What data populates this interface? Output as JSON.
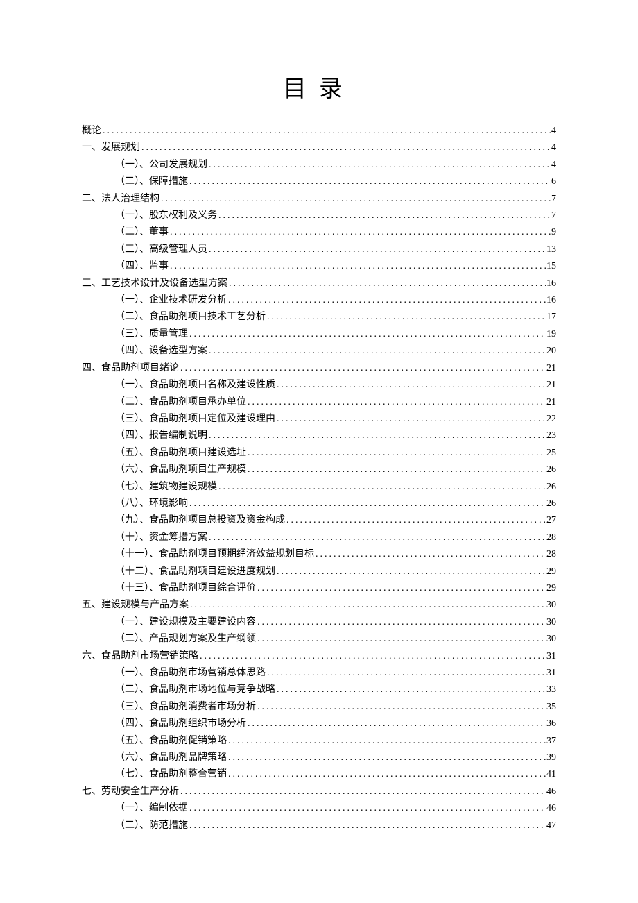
{
  "title": "目录",
  "toc": [
    {
      "level": 1,
      "label": "概论",
      "page": "4"
    },
    {
      "level": 1,
      "label": "一、发展规划",
      "page": "4"
    },
    {
      "level": 2,
      "label": "（一）、公司发展规划",
      "page": "4"
    },
    {
      "level": 2,
      "label": "（二）、保障措施",
      "page": "6"
    },
    {
      "level": 1,
      "label": "二、法人治理结构",
      "page": "7"
    },
    {
      "level": 2,
      "label": "（一）、股东权利及义务",
      "page": "7"
    },
    {
      "level": 2,
      "label": "（二）、董事",
      "page": "9"
    },
    {
      "level": 2,
      "label": "（三）、高级管理人员",
      "page": "13"
    },
    {
      "level": 2,
      "label": "（四）、监事",
      "page": "15"
    },
    {
      "level": 1,
      "label": "三、工艺技术设计及设备选型方案",
      "page": "16"
    },
    {
      "level": 2,
      "label": "（一）、企业技术研发分析",
      "page": "16"
    },
    {
      "level": 2,
      "label": "（二）、食品助剂项目技术工艺分析",
      "page": "17"
    },
    {
      "level": 2,
      "label": "（三）、质量管理",
      "page": "19"
    },
    {
      "level": 2,
      "label": "（四）、设备选型方案",
      "page": "20"
    },
    {
      "level": 1,
      "label": "四、食品助剂项目绪论",
      "page": "21"
    },
    {
      "level": 2,
      "label": "（一）、食品助剂项目名称及建设性质",
      "page": "21"
    },
    {
      "level": 2,
      "label": "（二）、食品助剂项目承办单位",
      "page": "21"
    },
    {
      "level": 2,
      "label": "（三）、食品助剂项目定位及建设理由",
      "page": "22"
    },
    {
      "level": 2,
      "label": "（四）、报告编制说明",
      "page": "23"
    },
    {
      "level": 2,
      "label": "（五）、食品助剂项目建设选址",
      "page": "25"
    },
    {
      "level": 2,
      "label": "（六）、食品助剂项目生产规模",
      "page": "26"
    },
    {
      "level": 2,
      "label": "（七）、建筑物建设规模",
      "page": "26"
    },
    {
      "level": 2,
      "label": "（八）、环境影响",
      "page": "26"
    },
    {
      "level": 2,
      "label": "（九）、食品助剂项目总投资及资金构成",
      "page": "27"
    },
    {
      "level": 2,
      "label": "（十）、资金筹措方案",
      "page": "28"
    },
    {
      "level": 2,
      "label": "（十一）、食品助剂项目预期经济效益规划目标",
      "page": "28"
    },
    {
      "level": 2,
      "label": "（十二）、食品助剂项目建设进度规划",
      "page": "29"
    },
    {
      "level": 2,
      "label": "（十三）、食品助剂项目综合评价",
      "page": "29"
    },
    {
      "level": 1,
      "label": "五、建设规模与产品方案",
      "page": "30"
    },
    {
      "level": 2,
      "label": "（一）、建设规模及主要建设内容",
      "page": "30"
    },
    {
      "level": 2,
      "label": "（二）、产品规划方案及生产纲领",
      "page": "30"
    },
    {
      "level": 1,
      "label": "六、食品助剂市场营销策略",
      "page": "31"
    },
    {
      "level": 2,
      "label": "（一）、食品助剂市场营销总体思路",
      "page": "31"
    },
    {
      "level": 2,
      "label": "（二）、食品助剂市场地位与竞争战略",
      "page": "33"
    },
    {
      "level": 2,
      "label": "（三）、食品助剂消费者市场分析",
      "page": "35"
    },
    {
      "level": 2,
      "label": "（四）、食品助剂组织市场分析",
      "page": "36"
    },
    {
      "level": 2,
      "label": "（五）、食品助剂促销策略",
      "page": "37"
    },
    {
      "level": 2,
      "label": "（六）、食品助剂品牌策略",
      "page": "39"
    },
    {
      "level": 2,
      "label": "（七）、食品助剂整合营销",
      "page": "41"
    },
    {
      "level": 1,
      "label": "七、劳动安全生产分析",
      "page": "46"
    },
    {
      "level": 2,
      "label": "（一）、编制依据",
      "page": "46"
    },
    {
      "level": 2,
      "label": "（二）、防范措施",
      "page": "47"
    }
  ]
}
